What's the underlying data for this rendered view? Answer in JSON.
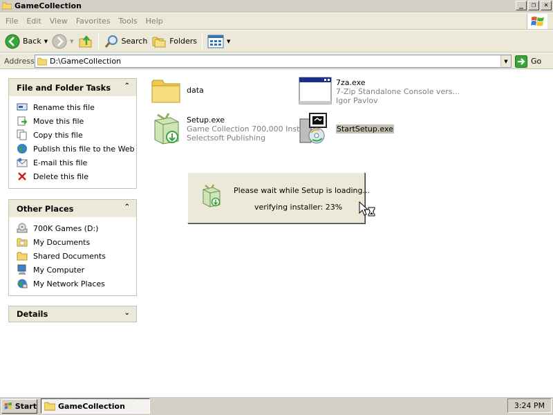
{
  "window": {
    "title": "GameCollection",
    "controls": {
      "minimize": "_",
      "maximize": "❐",
      "close": "✕"
    }
  },
  "menu": {
    "items": [
      "File",
      "Edit",
      "View",
      "Favorites",
      "Tools",
      "Help"
    ]
  },
  "toolbar": {
    "back": "Back",
    "search": "Search",
    "folders": "Folders"
  },
  "address": {
    "label": "Address",
    "path": "D:\\GameCollection",
    "go": "Go"
  },
  "tasks_pane": {
    "title": "File and Folder Tasks",
    "items": [
      {
        "label": "Rename this file",
        "icon": "rename-icon"
      },
      {
        "label": "Move this file",
        "icon": "move-icon"
      },
      {
        "label": "Copy this file",
        "icon": "copy-icon"
      },
      {
        "label": "Publish this file to the Web",
        "icon": "publish-web-icon"
      },
      {
        "label": "E-mail this file",
        "icon": "email-icon"
      },
      {
        "label": "Delete this file",
        "icon": "delete-icon"
      }
    ]
  },
  "places_pane": {
    "title": "Other Places",
    "items": [
      {
        "label": "700K Games (D:)",
        "icon": "cd-drive-icon"
      },
      {
        "label": "My Documents",
        "icon": "folder-icon"
      },
      {
        "label": "Shared Documents",
        "icon": "folder-icon"
      },
      {
        "label": "My Computer",
        "icon": "computer-icon"
      },
      {
        "label": "My Network Places",
        "icon": "network-icon"
      }
    ]
  },
  "details_pane": {
    "title": "Details"
  },
  "files": [
    {
      "name": "data",
      "desc1": "",
      "desc2": "",
      "icon": "folder-icon"
    },
    {
      "name": "7za.exe",
      "desc1": "7-Zip Standalone Console vers...",
      "desc2": "Igor Pavlov",
      "icon": "console-window-icon"
    },
    {
      "name": "Setup.exe",
      "desc1": "Game Collection 700,000 Inst...",
      "desc2": "Selectsoft Publishing",
      "icon": "installer-box-icon"
    },
    {
      "name": "StartSetup.exe",
      "desc1": "",
      "desc2": "",
      "icon": "setup-cd-icon"
    }
  ],
  "dialog": {
    "message": "Please wait while Setup is loading...",
    "progress_text": "verifying installer: 23%",
    "progress_percent": 23
  },
  "taskbar": {
    "start": "Start",
    "task": "GameCollection",
    "clock": "3:24 PM"
  },
  "colors": {
    "chrome": "#ece9d8",
    "classic_gray": "#d4d0c8",
    "disabled_text": "#7f7f7f",
    "selection": "#c5c2b2"
  }
}
